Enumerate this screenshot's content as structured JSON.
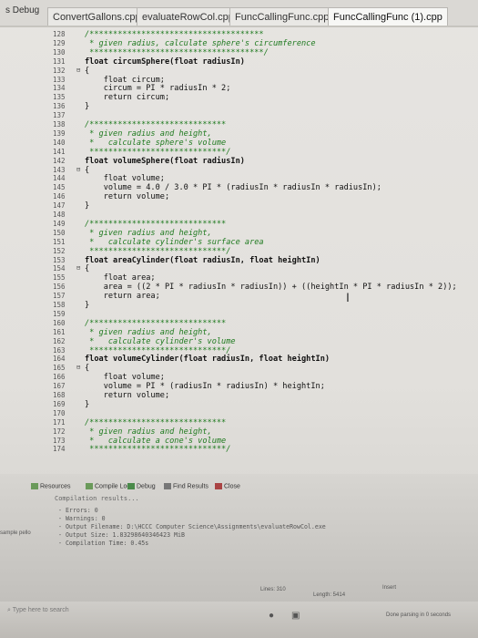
{
  "menu": {
    "debug": "s Debug"
  },
  "tabs": [
    {
      "label": "ConvertGallons.cpp"
    },
    {
      "label": "evaluateRowCol.cpp"
    },
    {
      "label": "FuncCallingFunc.cpp"
    },
    {
      "label": "FuncCallingFunc (1).cpp"
    }
  ],
  "editor": {
    "lines": [
      {
        "n": "128",
        "t": "/*************************************",
        "c": "cmt"
      },
      {
        "n": "129",
        "t": " * given radius, calculate sphere's circumference",
        "c": "cmt"
      },
      {
        "n": "130",
        "t": " *************************************/",
        "c": "cmt"
      },
      {
        "n": "131",
        "t": "float circumSphere(float radiusIn)",
        "c": "kw"
      },
      {
        "n": "132",
        "t": "{",
        "c": "",
        "fold": "⊟"
      },
      {
        "n": "133",
        "t": "    float circum;",
        "c": ""
      },
      {
        "n": "134",
        "t": "    circum = PI * radiusIn * 2;",
        "c": ""
      },
      {
        "n": "135",
        "t": "    return circum;",
        "c": ""
      },
      {
        "n": "136",
        "t": "}",
        "c": ""
      },
      {
        "n": "137",
        "t": "",
        "c": ""
      },
      {
        "n": "138",
        "t": "/*****************************",
        "c": "cmt"
      },
      {
        "n": "139",
        "t": " * given radius and height,",
        "c": "cmt"
      },
      {
        "n": "140",
        "t": " *   calculate sphere's volume",
        "c": "cmt"
      },
      {
        "n": "141",
        "t": " *****************************/",
        "c": "cmt"
      },
      {
        "n": "142",
        "t": "float volumeSphere(float radiusIn)",
        "c": "kw"
      },
      {
        "n": "143",
        "t": "{",
        "c": "",
        "fold": "⊟"
      },
      {
        "n": "144",
        "t": "    float volume;",
        "c": ""
      },
      {
        "n": "145",
        "t": "    volume = 4.0 / 3.0 * PI * (radiusIn * radiusIn * radiusIn);",
        "c": ""
      },
      {
        "n": "146",
        "t": "    return volume;",
        "c": ""
      },
      {
        "n": "147",
        "t": "}",
        "c": ""
      },
      {
        "n": "148",
        "t": "",
        "c": ""
      },
      {
        "n": "149",
        "t": "/*****************************",
        "c": "cmt"
      },
      {
        "n": "150",
        "t": " * given radius and height,",
        "c": "cmt"
      },
      {
        "n": "151",
        "t": " *   calculate cylinder's surface area",
        "c": "cmt"
      },
      {
        "n": "152",
        "t": " *****************************/",
        "c": "cmt"
      },
      {
        "n": "153",
        "t": "float areaCylinder(float radiusIn, float heightIn)",
        "c": "kw"
      },
      {
        "n": "154",
        "t": "{",
        "c": "",
        "fold": "⊟"
      },
      {
        "n": "155",
        "t": "    float area;",
        "c": ""
      },
      {
        "n": "156",
        "t": "    area = ((2 * PI * radiusIn * radiusIn)) + ((heightIn * PI * radiusIn * 2));",
        "c": ""
      },
      {
        "n": "157",
        "t": "    return area;",
        "c": ""
      },
      {
        "n": "158",
        "t": "}",
        "c": ""
      },
      {
        "n": "159",
        "t": "",
        "c": ""
      },
      {
        "n": "160",
        "t": "/*****************************",
        "c": "cmt"
      },
      {
        "n": "161",
        "t": " * given radius and height,",
        "c": "cmt"
      },
      {
        "n": "162",
        "t": " *   calculate cylinder's volume",
        "c": "cmt"
      },
      {
        "n": "163",
        "t": " *****************************/",
        "c": "cmt"
      },
      {
        "n": "164",
        "t": "float volumeCylinder(float radiusIn, float heightIn)",
        "c": "kw"
      },
      {
        "n": "165",
        "t": "{",
        "c": "",
        "fold": "⊟"
      },
      {
        "n": "166",
        "t": "    float volume;",
        "c": ""
      },
      {
        "n": "167",
        "t": "    volume = PI * (radiusIn * radiusIn) * heightIn;",
        "c": ""
      },
      {
        "n": "168",
        "t": "    return volume;",
        "c": ""
      },
      {
        "n": "169",
        "t": "}",
        "c": ""
      },
      {
        "n": "170",
        "t": "",
        "c": ""
      },
      {
        "n": "171",
        "t": "/*****************************",
        "c": "cmt"
      },
      {
        "n": "172",
        "t": " * given radius and height,",
        "c": "cmt"
      },
      {
        "n": "173",
        "t": " *   calculate a cone's volume",
        "c": "cmt"
      },
      {
        "n": "174",
        "t": " *****************************/",
        "c": "cmt"
      }
    ]
  },
  "panel": {
    "tabs": [
      "Resources",
      "Compile Log",
      "Debug",
      "Find Results",
      "Close"
    ],
    "title": "Compilation results...",
    "output": [
      "- Errors: 0",
      "- Warnings: 0",
      "- Output Filename: D:\\HCCC Computer Science\\Assignments\\evaluateRowCol.exe",
      "- Output Size: 1.83298640346423 MiB",
      "- Compilation Time: 0.45s"
    ],
    "side_label": "sample pello"
  },
  "statusbar": {
    "lines": "Lines: 310",
    "length": "Length: 5414",
    "insert": "Insert"
  },
  "taskbar": {
    "search_placeholder": "Type here to search",
    "status": "Done parsing in 0 seconds"
  }
}
